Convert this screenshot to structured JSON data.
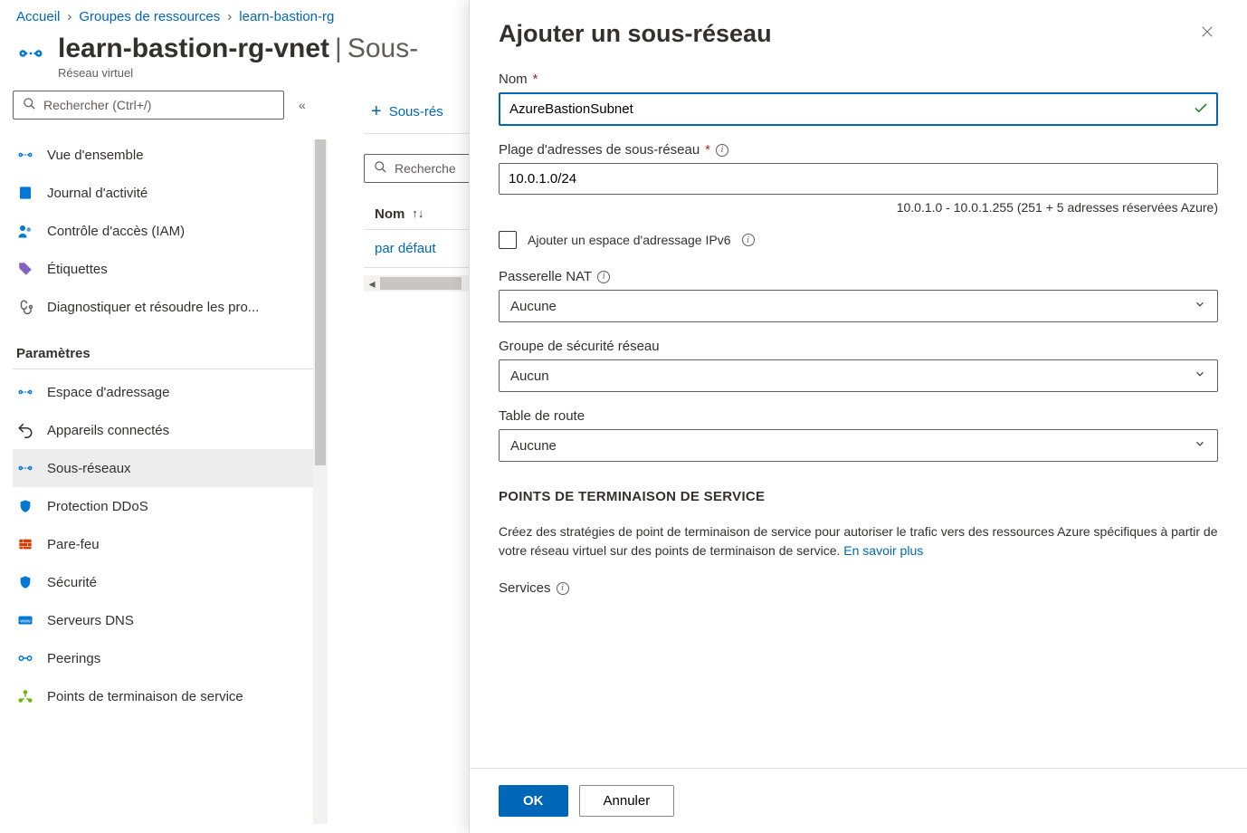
{
  "breadcrumb": {
    "home": "Accueil",
    "groups": "Groupes de ressources",
    "rg": "learn-bastion-rg"
  },
  "header": {
    "title": "learn-bastion-rg-vnet",
    "suffix": "Sous-",
    "subtitle": "Réseau virtuel"
  },
  "sidebar": {
    "search_placeholder": "Rechercher (Ctrl+/)",
    "items_top": [
      {
        "label": "Vue d'ensemble",
        "icon": "overview"
      },
      {
        "label": "Journal d'activité",
        "icon": "log"
      },
      {
        "label": "Contrôle d'accès (IAM)",
        "icon": "iam"
      },
      {
        "label": "Étiquettes",
        "icon": "tag"
      },
      {
        "label": "Diagnostiquer et résoudre les pro...",
        "icon": "diagnose"
      }
    ],
    "section": "Paramètres",
    "items_settings": [
      {
        "label": "Espace d'adressage",
        "icon": "address"
      },
      {
        "label": "Appareils connectés",
        "icon": "devices"
      },
      {
        "label": "Sous-réseaux",
        "icon": "subnets",
        "selected": true
      },
      {
        "label": "Protection DDoS",
        "icon": "ddos"
      },
      {
        "label": "Pare-feu",
        "icon": "firewall"
      },
      {
        "label": "Sécurité",
        "icon": "security"
      },
      {
        "label": "Serveurs DNS",
        "icon": "dns"
      },
      {
        "label": "Peerings",
        "icon": "peerings"
      },
      {
        "label": "Points de terminaison de service",
        "icon": "endpoints"
      }
    ]
  },
  "content": {
    "add_subnet": "Sous-rés",
    "search": "Recherche",
    "column_name": "Nom",
    "row_default": "par défaut"
  },
  "panel": {
    "title": "Ajouter un sous-réseau",
    "name_label": "Nom",
    "name_value": "AzureBastionSubnet",
    "range_label": "Plage d'adresses de sous-réseau",
    "range_value": "10.0.1.0/24",
    "range_help": "10.0.1.0 - 10.0.1.255  (251 + 5 adresses réservées Azure)",
    "ipv6_label": "Ajouter un espace d'adressage IPv6",
    "nat_label": "Passerelle NAT",
    "nat_value": "Aucune",
    "nsg_label": "Groupe de sécurité réseau",
    "nsg_value": "Aucun",
    "route_label": "Table de route",
    "route_value": "Aucune",
    "endpoints_heading": "POINTS DE TERMINAISON DE SERVICE",
    "endpoints_desc": "Créez des stratégies de point de terminaison de service pour autoriser le trafic vers des ressources Azure spécifiques à partir de votre réseau virtuel sur des points de terminaison de service. ",
    "endpoints_link": "En savoir plus",
    "services_label": "Services",
    "ok": "OK",
    "cancel": "Annuler"
  }
}
